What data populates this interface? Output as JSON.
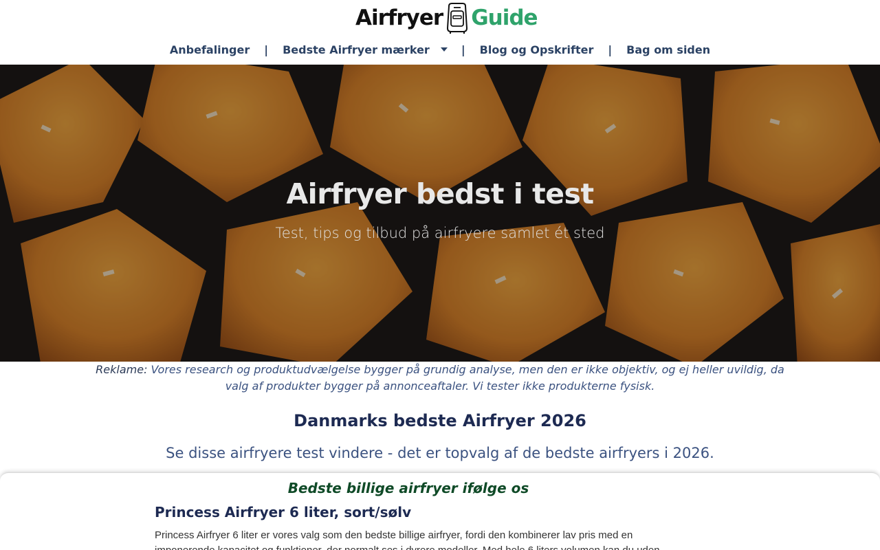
{
  "header": {
    "logo_part1": "Airfryer",
    "logo_part2": "Guide",
    "logo_icon": "airfryer-icon",
    "brand_color": "#2fa36b"
  },
  "nav": {
    "items": [
      {
        "label": "Anbefalinger"
      },
      {
        "label": "Bedste Airfryer mærker",
        "has_dropdown": true
      },
      {
        "label": "Blog og Opskrifter"
      },
      {
        "label": "Bag om siden"
      }
    ],
    "separator": "|"
  },
  "hero": {
    "title": "Airfryer bedst i test",
    "subtitle": "Test, tips og tilbud på airfryere samlet ét sted"
  },
  "disclaimer": {
    "label": "Reklame:",
    "text": " Vores research og produktudvælgelse bygger på grundig analyse, men den er ikke objektiv, og ej heller uvildig, da valg af produkter bygger på annonceaftaler. Vi tester ikke produkterne fysisk."
  },
  "section": {
    "title": "Danmarks bedste Airfryer 2026",
    "subtitle": "Se disse airfryere test vindere - det er topvalg af de bedste airfryers i 2026."
  },
  "card": {
    "badge": "Bedste billige airfryer ifølge os",
    "title": "Princess Airfryer 6 liter, sort/sølv",
    "text": "Princess Airfryer 6 liter er vores valg som den bedste billige airfryer, fordi den kombinerer lav pris med en imponerende kapacitet og funktioner, der normalt ses i dyrere modeller. Med hele 6 liters volumen kan du uden"
  }
}
